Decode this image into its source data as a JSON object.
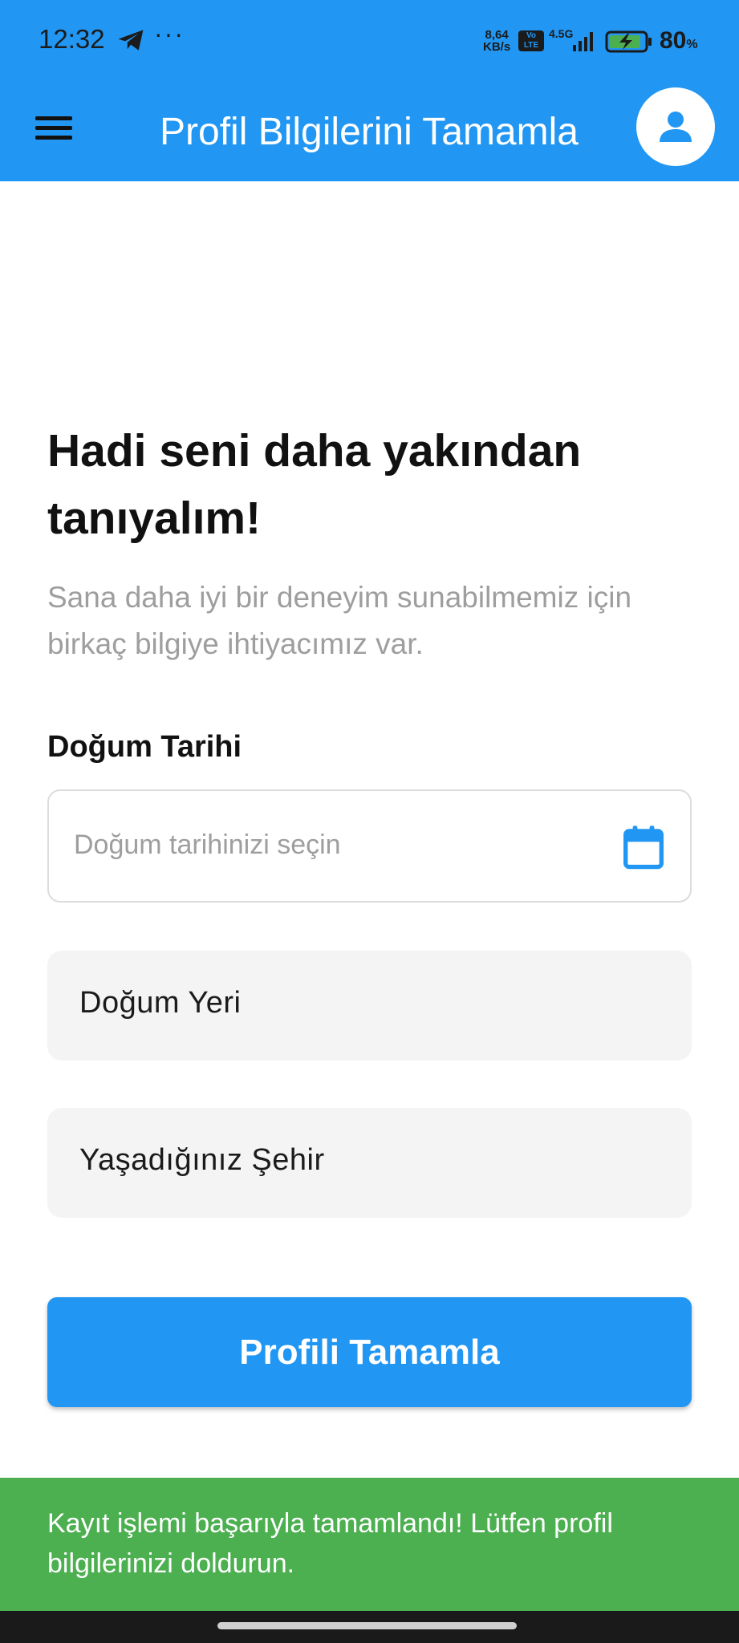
{
  "status_bar": {
    "time": "12:32",
    "dots": "···",
    "speed_value": "8,64",
    "speed_unit": "KB/s",
    "volte": "Vo\nLTE",
    "network": "4.5G",
    "battery_percent": "80",
    "battery_percent_sign": "%"
  },
  "app_bar": {
    "title": "Profil Bilgilerini Tamamla",
    "background_color": "#2196f3"
  },
  "intro": {
    "heading": "Hadi seni daha yakından tanıyalım!",
    "subtitle": "Sana daha iyi bir deneyim sunabilmemiz için birkaç bilgiye ihtiyacımız var."
  },
  "form": {
    "birth_date": {
      "label": "Doğum Tarihi",
      "placeholder": "Doğum tarihinizi seçin"
    },
    "birth_place": {
      "placeholder": "Doğum Yeri"
    },
    "city": {
      "placeholder": "Yaşadığınız Şehir"
    },
    "submit_label": "Profili Tamamla"
  },
  "snackbar": {
    "message": "Kayıt işlemi başarıyla tamamlandı! Lütfen profil bilgilerinizi doldurun.",
    "color": "#4caf50"
  },
  "icons": {
    "menu": "hamburger-menu-icon",
    "profile": "person-icon",
    "calendar": "calendar-icon",
    "telegram": "telegram-icon"
  }
}
